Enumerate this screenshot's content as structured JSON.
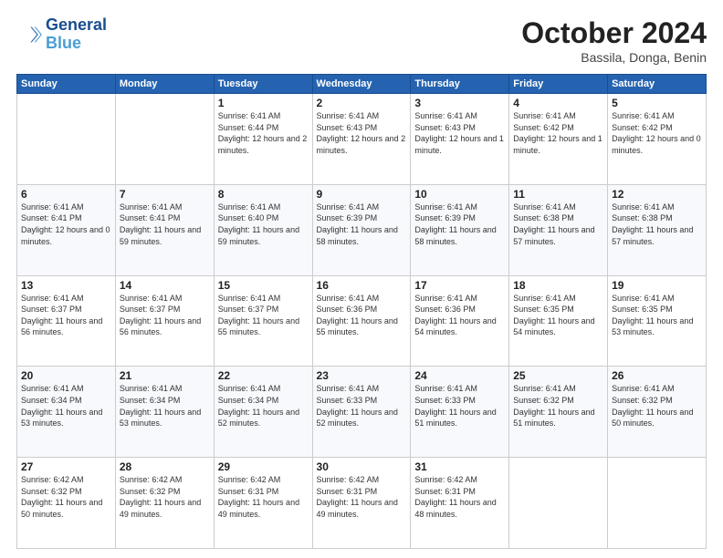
{
  "logo": {
    "line1": "General",
    "line2": "Blue"
  },
  "title": "October 2024",
  "location": "Bassila, Donga, Benin",
  "weekdays": [
    "Sunday",
    "Monday",
    "Tuesday",
    "Wednesday",
    "Thursday",
    "Friday",
    "Saturday"
  ],
  "weeks": [
    [
      {
        "day": "",
        "info": ""
      },
      {
        "day": "",
        "info": ""
      },
      {
        "day": "1",
        "info": "Sunrise: 6:41 AM\nSunset: 6:44 PM\nDaylight: 12 hours\nand 2 minutes."
      },
      {
        "day": "2",
        "info": "Sunrise: 6:41 AM\nSunset: 6:43 PM\nDaylight: 12 hours\nand 2 minutes."
      },
      {
        "day": "3",
        "info": "Sunrise: 6:41 AM\nSunset: 6:43 PM\nDaylight: 12 hours\nand 1 minute."
      },
      {
        "day": "4",
        "info": "Sunrise: 6:41 AM\nSunset: 6:42 PM\nDaylight: 12 hours\nand 1 minute."
      },
      {
        "day": "5",
        "info": "Sunrise: 6:41 AM\nSunset: 6:42 PM\nDaylight: 12 hours\nand 0 minutes."
      }
    ],
    [
      {
        "day": "6",
        "info": "Sunrise: 6:41 AM\nSunset: 6:41 PM\nDaylight: 12 hours\nand 0 minutes."
      },
      {
        "day": "7",
        "info": "Sunrise: 6:41 AM\nSunset: 6:41 PM\nDaylight: 11 hours\nand 59 minutes."
      },
      {
        "day": "8",
        "info": "Sunrise: 6:41 AM\nSunset: 6:40 PM\nDaylight: 11 hours\nand 59 minutes."
      },
      {
        "day": "9",
        "info": "Sunrise: 6:41 AM\nSunset: 6:39 PM\nDaylight: 11 hours\nand 58 minutes."
      },
      {
        "day": "10",
        "info": "Sunrise: 6:41 AM\nSunset: 6:39 PM\nDaylight: 11 hours\nand 58 minutes."
      },
      {
        "day": "11",
        "info": "Sunrise: 6:41 AM\nSunset: 6:38 PM\nDaylight: 11 hours\nand 57 minutes."
      },
      {
        "day": "12",
        "info": "Sunrise: 6:41 AM\nSunset: 6:38 PM\nDaylight: 11 hours\nand 57 minutes."
      }
    ],
    [
      {
        "day": "13",
        "info": "Sunrise: 6:41 AM\nSunset: 6:37 PM\nDaylight: 11 hours\nand 56 minutes."
      },
      {
        "day": "14",
        "info": "Sunrise: 6:41 AM\nSunset: 6:37 PM\nDaylight: 11 hours\nand 56 minutes."
      },
      {
        "day": "15",
        "info": "Sunrise: 6:41 AM\nSunset: 6:37 PM\nDaylight: 11 hours\nand 55 minutes."
      },
      {
        "day": "16",
        "info": "Sunrise: 6:41 AM\nSunset: 6:36 PM\nDaylight: 11 hours\nand 55 minutes."
      },
      {
        "day": "17",
        "info": "Sunrise: 6:41 AM\nSunset: 6:36 PM\nDaylight: 11 hours\nand 54 minutes."
      },
      {
        "day": "18",
        "info": "Sunrise: 6:41 AM\nSunset: 6:35 PM\nDaylight: 11 hours\nand 54 minutes."
      },
      {
        "day": "19",
        "info": "Sunrise: 6:41 AM\nSunset: 6:35 PM\nDaylight: 11 hours\nand 53 minutes."
      }
    ],
    [
      {
        "day": "20",
        "info": "Sunrise: 6:41 AM\nSunset: 6:34 PM\nDaylight: 11 hours\nand 53 minutes."
      },
      {
        "day": "21",
        "info": "Sunrise: 6:41 AM\nSunset: 6:34 PM\nDaylight: 11 hours\nand 53 minutes."
      },
      {
        "day": "22",
        "info": "Sunrise: 6:41 AM\nSunset: 6:34 PM\nDaylight: 11 hours\nand 52 minutes."
      },
      {
        "day": "23",
        "info": "Sunrise: 6:41 AM\nSunset: 6:33 PM\nDaylight: 11 hours\nand 52 minutes."
      },
      {
        "day": "24",
        "info": "Sunrise: 6:41 AM\nSunset: 6:33 PM\nDaylight: 11 hours\nand 51 minutes."
      },
      {
        "day": "25",
        "info": "Sunrise: 6:41 AM\nSunset: 6:32 PM\nDaylight: 11 hours\nand 51 minutes."
      },
      {
        "day": "26",
        "info": "Sunrise: 6:41 AM\nSunset: 6:32 PM\nDaylight: 11 hours\nand 50 minutes."
      }
    ],
    [
      {
        "day": "27",
        "info": "Sunrise: 6:42 AM\nSunset: 6:32 PM\nDaylight: 11 hours\nand 50 minutes."
      },
      {
        "day": "28",
        "info": "Sunrise: 6:42 AM\nSunset: 6:32 PM\nDaylight: 11 hours\nand 49 minutes."
      },
      {
        "day": "29",
        "info": "Sunrise: 6:42 AM\nSunset: 6:31 PM\nDaylight: 11 hours\nand 49 minutes."
      },
      {
        "day": "30",
        "info": "Sunrise: 6:42 AM\nSunset: 6:31 PM\nDaylight: 11 hours\nand 49 minutes."
      },
      {
        "day": "31",
        "info": "Sunrise: 6:42 AM\nSunset: 6:31 PM\nDaylight: 11 hours\nand 48 minutes."
      },
      {
        "day": "",
        "info": ""
      },
      {
        "day": "",
        "info": ""
      }
    ]
  ]
}
